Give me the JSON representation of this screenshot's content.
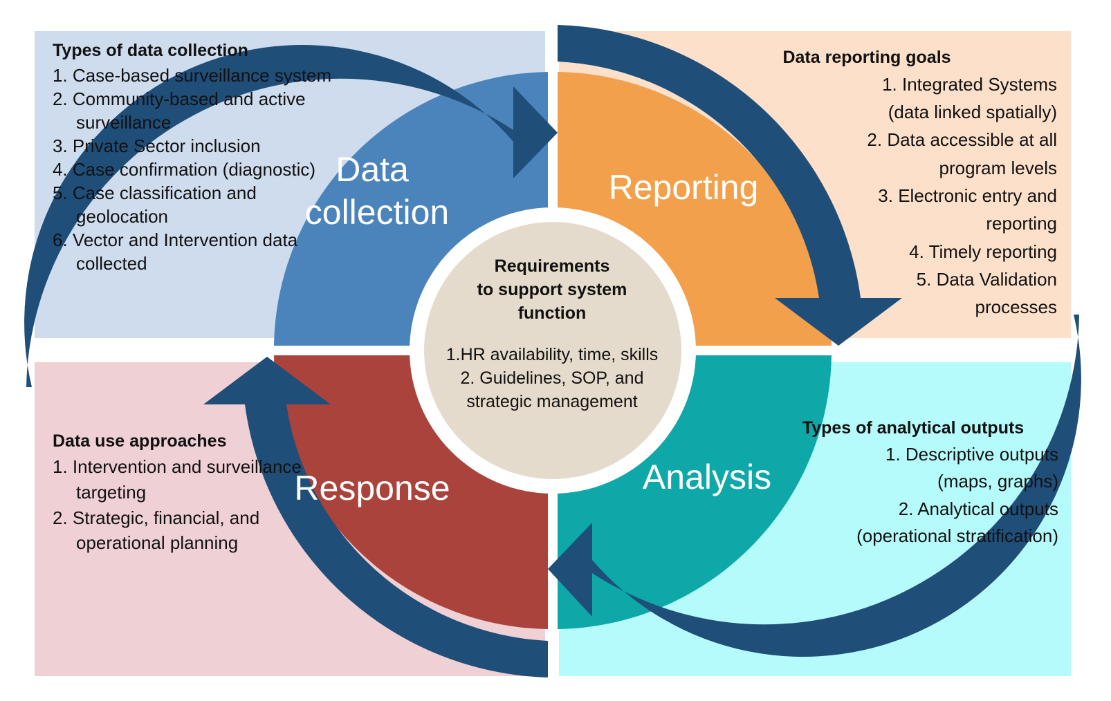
{
  "diagram": {
    "title": "Surveillance data cycle",
    "hub": {
      "title_line1": "Requirements",
      "title_line2": "to support system",
      "title_line3": "function",
      "items": [
        "1.HR availability, time, skills",
        "2. Guidelines, SOP, and",
        "strategic management"
      ]
    },
    "quadrants": [
      {
        "id": "data-collection",
        "label_line1": "Data",
        "label_line2": "collection",
        "color": "#4b84bb",
        "panel_color": "#cfdcee",
        "heading": "Types of data collection",
        "items": [
          "1. Case-based surveillance system",
          "2. Community-based and active surveillance",
          "3. Private Sector inclusion",
          "4. Case confirmation (diagnostic)",
          "5. Case classification and geolocation",
          "6. Vector and Intervention data collected"
        ]
      },
      {
        "id": "reporting",
        "label_line1": "Reporting",
        "label_line2": "",
        "color": "#f2a04b",
        "panel_color": "#fce0ca",
        "heading": "Data reporting goals",
        "items": [
          "1. Integrated Systems",
          "(data linked spatially)",
          "2. Data accessible at all",
          "program levels",
          "3. Electronic entry and",
          "reporting",
          "4. Timely reporting",
          "5. Data Validation",
          "processes"
        ]
      },
      {
        "id": "analysis",
        "label_line1": "Analysis",
        "label_line2": "",
        "color": "#0fa8a8",
        "panel_color": "#b6fbfb",
        "heading": "Types of analytical outputs",
        "items": [
          "1. Descriptive  outputs",
          "(maps, graphs)",
          "2. Analytical outputs",
          "(operational  stratification)"
        ]
      },
      {
        "id": "response",
        "label_line1": "Response",
        "label_line2": "",
        "color": "#a9433c",
        "panel_color": "#efd0d4",
        "heading": "Data use approaches",
        "items": [
          "1. Intervention and surveillance targeting",
          "2. Strategic, financial, and operational planning"
        ]
      }
    ],
    "colors": {
      "arrow_ring": "#1f4e79",
      "hub_fill": "#e5dbcc",
      "hub_ring": "#ffffff",
      "text": "#111111",
      "wedge_label": "#ffffff"
    },
    "arrows": [
      {
        "name": "collection-to-reporting",
        "direction": "right"
      },
      {
        "name": "reporting-to-analysis",
        "direction": "down"
      },
      {
        "name": "analysis-to-response",
        "direction": "left"
      },
      {
        "name": "response-to-collection",
        "direction": "up"
      }
    ]
  }
}
